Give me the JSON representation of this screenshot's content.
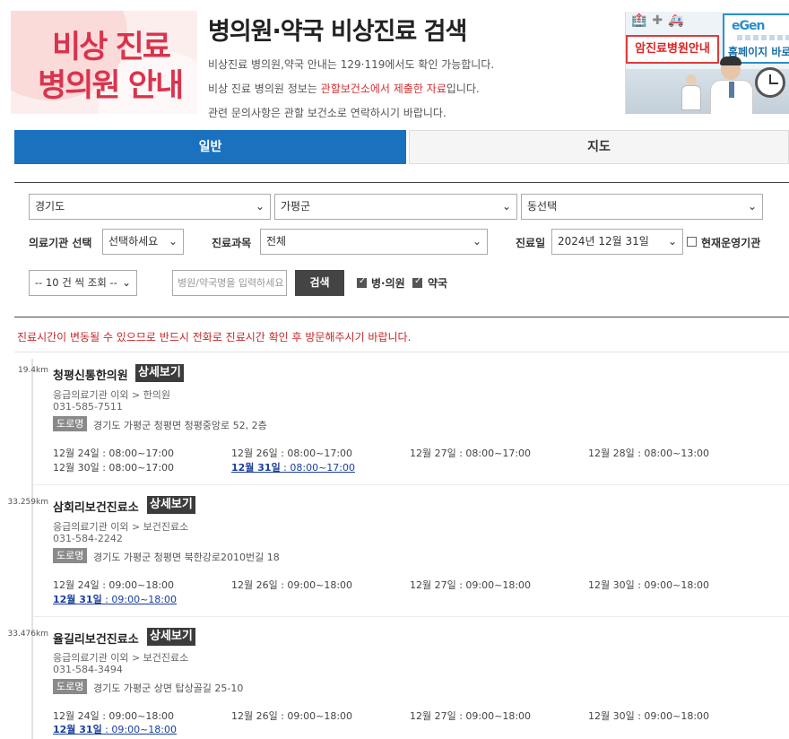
{
  "header": {
    "logo_line1": "비상 진료",
    "logo_line2": "병의원 안내",
    "title": "병의원·약국 비상진료 검색",
    "info1": "비상진료 병의원,약국 안내는 129·119에서도 확인 가능합니다.",
    "info2_pre": "비상 진료 병의원 정보는 ",
    "info2_red": "관할보건소에서 제출한 자료",
    "info2_post": "입니다.",
    "info3": "관련 문의사항은 관할 보건소로 연락하시기 바랍니다.",
    "banner_left": "암진료병원안내",
    "banner_right_logo": "eGen",
    "banner_right": "홈페이지 바로가"
  },
  "tabs": [
    {
      "label": "일반",
      "active": true
    },
    {
      "label": "지도",
      "active": false
    }
  ],
  "search": {
    "province": "경기도",
    "county": "가평군",
    "dong": "동선택",
    "institution_label": "의료기관 선택",
    "institution_value": "선택하세요",
    "department_label": "진료과목",
    "department_value": "전체",
    "date_label": "진료일",
    "date_value": "2024년 12월 31일",
    "open_now_label": "현재운영기관",
    "open_now_checked": false,
    "page_size": "-- 10 건 씩 조회 --",
    "name_placeholder": "병원/약국명을 입력하세요",
    "search_button": "검색",
    "hospital_label": "병·의원",
    "hospital_checked": true,
    "pharmacy_label": "약국",
    "pharmacy_checked": true
  },
  "notice": "진료시간이 변동될 수 있으므로 반드시 전화로 진료시간 확인 후 방문해주시기 바랍니다.",
  "detail_label": "상세보기",
  "road_label": "도로명",
  "results": [
    {
      "distance": "19.4km",
      "name": "청평신통한의원",
      "category": "응급의료기관 이외 > 한의원",
      "phone": "031-585-7511",
      "address": "경기도 가평군 청평면 청평중앙로 52, 2층",
      "schedule": [
        {
          "day": "12월 24일",
          "time": " : 08:00~17:00",
          "today": false
        },
        {
          "day": "12월 26일",
          "time": " : 08:00~17:00",
          "today": false
        },
        {
          "day": "12월 27일",
          "time": " : 08:00~17:00",
          "today": false
        },
        {
          "day": "12월 28일",
          "time": " : 08:00~13:00",
          "today": false
        },
        {
          "day": "12월 30일",
          "time": " : 08:00~17:00",
          "today": false
        },
        {
          "day": "12월 31일",
          "time": " : 08:00~17:00",
          "today": true
        }
      ]
    },
    {
      "distance": "33.259km",
      "name": "삼회리보건진료소",
      "category": "응급의료기관 이외 > 보건진료소",
      "phone": "031-584-2242",
      "address": "경기도 가평군 청평면 북한강로2010번길 18",
      "schedule": [
        {
          "day": "12월 24일",
          "time": " : 09:00~18:00",
          "today": false
        },
        {
          "day": "12월 26일",
          "time": " : 09:00~18:00",
          "today": false
        },
        {
          "day": "12월 27일",
          "time": " : 09:00~18:00",
          "today": false
        },
        {
          "day": "12월 30일",
          "time": " : 09:00~18:00",
          "today": false
        },
        {
          "day": "12월 31일",
          "time": " : 09:00~18:00",
          "today": true
        }
      ]
    },
    {
      "distance": "33.476km",
      "name": "율길리보건진료소",
      "category": "응급의료기관 이외 > 보건진료소",
      "phone": "031-584-3494",
      "address": "경기도 가평군 상면 탑상골길 25-10",
      "schedule": [
        {
          "day": "12월 24일",
          "time": " : 09:00~18:00",
          "today": false
        },
        {
          "day": "12월 26일",
          "time": " : 09:00~18:00",
          "today": false
        },
        {
          "day": "12월 27일",
          "time": " : 09:00~18:00",
          "today": false
        },
        {
          "day": "12월 30일",
          "time": " : 09:00~18:00",
          "today": false
        },
        {
          "day": "12월 31일",
          "time": " : 09:00~18:00",
          "today": true
        }
      ]
    }
  ],
  "colors": {
    "tab_active": "#1a72bf",
    "logo_red": "#d9344d",
    "notice_red": "#c62828",
    "today_link": "#1a3f9c",
    "detail_button": "#3c3c3c"
  }
}
